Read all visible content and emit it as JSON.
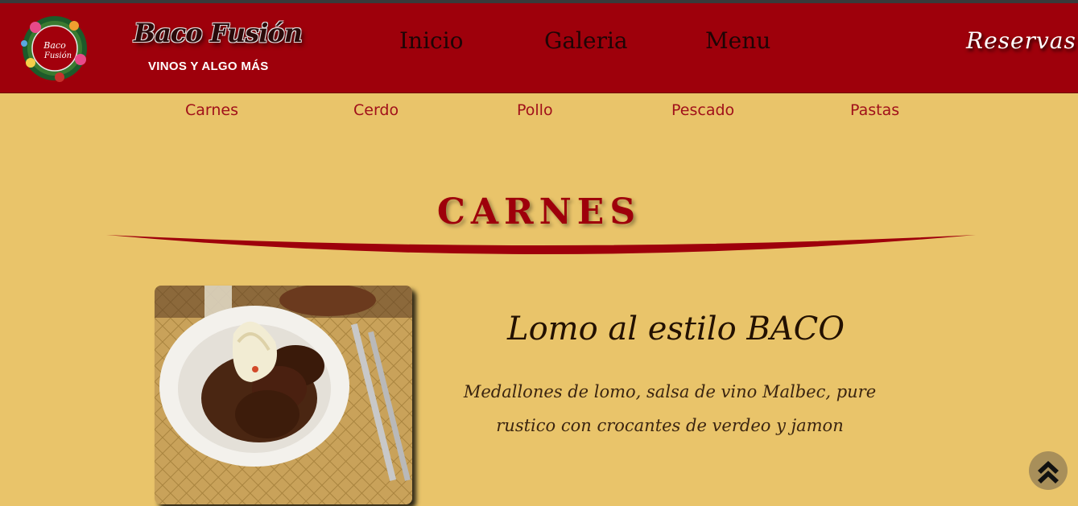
{
  "brand": {
    "name": "Baco Fusión",
    "tagline": "VINOS Y ALGO MÁS",
    "logo_text": "Baco Fusión"
  },
  "nav": {
    "items": [
      {
        "label": "Inicio"
      },
      {
        "label": "Galeria"
      },
      {
        "label": "Menu"
      }
    ],
    "reservas": "Reservas"
  },
  "subnav": {
    "items": [
      {
        "label": "Carnes"
      },
      {
        "label": "Cerdo"
      },
      {
        "label": "Pollo"
      },
      {
        "label": "Pescado"
      },
      {
        "label": "Pastas"
      }
    ]
  },
  "section": {
    "title": "CARNES"
  },
  "dish": {
    "title": "Lomo al estilo BACO",
    "description_line1": "Medallones de lomo, salsa de vino Malbec, pure",
    "description_line2": "rustico con crocantes de verdeo y jamon"
  },
  "icons": {
    "scroll_top": "double-chevron-up-icon"
  },
  "colors": {
    "header_bg": "#9e000b",
    "page_bg": "#e9c46a",
    "accent": "#9e000b",
    "subnav_text": "#a0101a"
  }
}
